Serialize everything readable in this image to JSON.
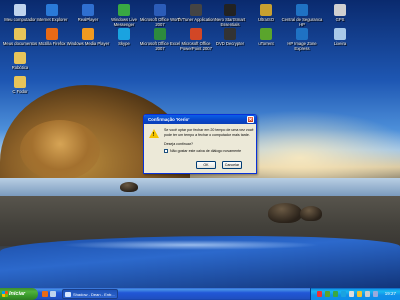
{
  "desktop": {
    "icons": [
      {
        "label": "Meu computador",
        "icon": "my-computer-icon",
        "color": "#c0d4ee"
      },
      {
        "label": "Internet Explorer",
        "icon": "internet-explorer-icon",
        "color": "#2a7ad8"
      },
      {
        "label": "RealPlayer",
        "icon": "realplayer-icon",
        "color": "#2f6fd0"
      },
      {
        "label": "Windows Live Messenger",
        "icon": "messenger-icon",
        "color": "#39a843"
      },
      {
        "label": "Microsoft Office Word 2007",
        "icon": "word-icon",
        "color": "#2b5cb8"
      },
      {
        "label": "TVTuner Application",
        "icon": "tvtuner-icon",
        "color": "#444444"
      },
      {
        "label": "Nero StartSmart Essentials",
        "icon": "nero-icon",
        "color": "#222222"
      },
      {
        "label": "UltraISO",
        "icon": "ultraiso-icon",
        "color": "#c8a030"
      },
      {
        "label": "Central de Seguranca HP",
        "icon": "hp-security-icon",
        "color": "#1f72c4"
      },
      {
        "label": "GPS",
        "icon": "gps-icon",
        "color": "#d0d0d0"
      },
      {
        "label": "Meus documentos",
        "icon": "my-documents-icon",
        "color": "#e7c45a"
      },
      {
        "label": "Mozilla Firefox",
        "icon": "firefox-icon",
        "color": "#e86a16"
      },
      {
        "label": "Windows Media Player",
        "icon": "media-player-icon",
        "color": "#f19a20"
      },
      {
        "label": "Skype",
        "icon": "skype-icon",
        "color": "#1aa3e0"
      },
      {
        "label": "Microsoft Office Excel 2007",
        "icon": "excel-icon",
        "color": "#2d8a3d"
      },
      {
        "label": "Microsoft Office PowerPoint 2007",
        "icon": "powerpoint-icon",
        "color": "#d24726"
      },
      {
        "label": "DVD Decrypter",
        "icon": "dvd-decrypter-icon",
        "color": "#333333"
      },
      {
        "label": "uTorrent",
        "icon": "utorrent-icon",
        "color": "#5aa52c"
      },
      {
        "label": "HP Image Zone Express",
        "icon": "hp-image-zone-icon",
        "color": "#1f72c4"
      },
      {
        "label": "Lixeira",
        "icon": "recycle-bin-icon",
        "color": "#a9c9e8"
      },
      {
        "label": "Robótica",
        "icon": "folder-icon",
        "color": "#e7c45a"
      },
      {
        "label": "C Fodor",
        "icon": "folder-icon",
        "color": "#e7c45a"
      }
    ]
  },
  "dialog": {
    "title": "Confirmação 'Kerio'",
    "close_glyph": "✕",
    "message": "Se você optar por fechar em 20 tempo de uma vez você pode ter um tempo a fechar o computador mais tarde.",
    "question": "Deseja continuar?",
    "checkbox_label": "Não gostar este caixa de diálogo novamente",
    "ok_label": "OK",
    "cancel_label": "Cancelar",
    "warning_glyph": "!"
  },
  "taskbar": {
    "start_label": "Iniciar",
    "window_button": "Shadow - Dean - Entr...",
    "clock": "19:27"
  }
}
